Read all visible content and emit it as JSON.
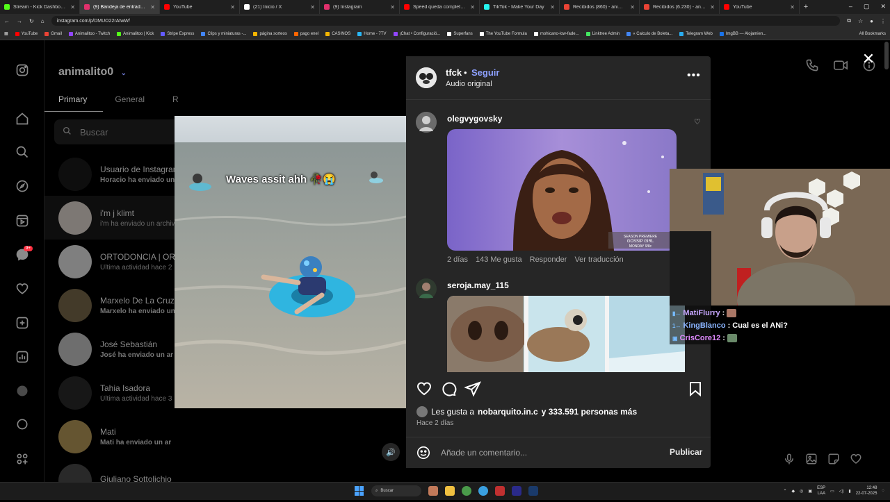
{
  "browser": {
    "tabs": [
      {
        "title": "Stream - Kick Dashboard",
        "color": "#53fc18"
      },
      {
        "title": "(9) Bandeja de entrada • C",
        "color": "#e1306c",
        "active": true
      },
      {
        "title": "YouTube",
        "color": "#ff0000"
      },
      {
        "title": "(21) Inicio / X",
        "color": "#ffffff"
      },
      {
        "title": "(9) Instagram",
        "color": "#e1306c"
      },
      {
        "title": "Speed queda completamente",
        "color": "#ff0000"
      },
      {
        "title": "TikTok - Make Your Day",
        "color": "#25f4ee"
      },
      {
        "title": "Recibidos (860) - animalitoo",
        "color": "#ea4335"
      },
      {
        "title": "Recibidos (6.230) - anibalnar",
        "color": "#ea4335"
      },
      {
        "title": "YouTube",
        "color": "#ff0000"
      }
    ],
    "url": "instagram.com/p/DMUO22rAtwW/",
    "bookmarks": [
      {
        "label": "YouTube",
        "color": "#ff0000"
      },
      {
        "label": "Gmail",
        "color": "#ea4335"
      },
      {
        "label": "Animalitoo - Twitch",
        "color": "#9146ff"
      },
      {
        "label": "Animalitoo | Kick",
        "color": "#53fc18"
      },
      {
        "label": "Stripe Express",
        "color": "#635bff"
      },
      {
        "label": "Clips y miniaturas -...",
        "color": "#4285f4"
      },
      {
        "label": "página sorteos",
        "color": "#f4b400"
      },
      {
        "label": "pago enel",
        "color": "#ff6600"
      },
      {
        "label": "CASINOS",
        "color": "#f4b400"
      },
      {
        "label": "Home - 7TV",
        "color": "#29b6f6"
      },
      {
        "label": "¡Chat • Configuració...",
        "color": "#9146ff"
      },
      {
        "label": "Superfans",
        "color": "#ffffff"
      },
      {
        "label": "The YouTube Formula",
        "color": "#ffffff"
      },
      {
        "label": "mohicano-low-fade...",
        "color": "#ffffff"
      },
      {
        "label": "Linktree Admin",
        "color": "#43e660"
      },
      {
        "label": "« Calculo de Boleta...",
        "color": "#4285f4"
      },
      {
        "label": "Telegram Web",
        "color": "#2aabee"
      },
      {
        "label": "ImgBB — Alojamien...",
        "color": "#1a73e8"
      }
    ],
    "all_bookmarks": "All Bookmarks",
    "window_controls": [
      "–",
      "▢",
      "✕"
    ]
  },
  "instagram": {
    "username": "animalito0",
    "tabs": [
      "Primary",
      "General",
      "R"
    ],
    "search_placeholder": "Buscar",
    "badge": "9+",
    "conversations": [
      {
        "name": "Usuario de Instagram",
        "sub": "Horacio ha enviado un archivo",
        "bold": true
      },
      {
        "name": "i'm j klimt",
        "sub": "i'm ha enviado un archivo",
        "bold": false,
        "selected": true
      },
      {
        "name": "ORTODONCIA | ORTO",
        "sub": "Última actividad hace 2",
        "bold": false
      },
      {
        "name": "Marxelo De La Cruz",
        "sub": "Marxelo ha enviado un",
        "bold": true
      },
      {
        "name": "José Sebastián",
        "sub": "José ha enviado un ar",
        "bold": true
      },
      {
        "name": "Tahia Isadora",
        "sub": "Última actividad hace 3",
        "bold": false
      },
      {
        "name": "Mati",
        "sub": "Mati ha enviado un ar",
        "bold": true
      },
      {
        "name": "Giuliano Sottolichio",
        "sub": "",
        "bold": false
      }
    ]
  },
  "video": {
    "caption": "Waves assit ahh 🥀😭"
  },
  "post": {
    "author": "tfck",
    "follow": "Seguir",
    "audio": "Audio original",
    "comments": [
      {
        "user": "olegvygovsky",
        "time": "2 días",
        "likes": "143 Me gusta",
        "reply": "Responder",
        "translate": "Ver traducción",
        "gif_text": "SEASON PREMIERE GOSSIP GIRL MONDAY 9/8c"
      },
      {
        "user": "seroja.may_115"
      }
    ],
    "likes_prefix": "Les gusta a",
    "likes_user": "nobarquito.in.c",
    "likes_suffix": "y 333.591 personas más",
    "time": "Hace 2 días",
    "comment_placeholder": "Añade un comentario...",
    "publish": "Publicar"
  },
  "stream_chat": [
    {
      "user": "MatiFlurry",
      "message": ""
    },
    {
      "user": "KingBlanco",
      "message": "Cual es el ANi?"
    },
    {
      "user": "CrisCore12",
      "message": ""
    }
  ],
  "taskbar": {
    "search": "Buscar",
    "lang_1": "ESP",
    "lang_2": "LAA",
    "time": "12:48",
    "date": "22-07-2025"
  }
}
